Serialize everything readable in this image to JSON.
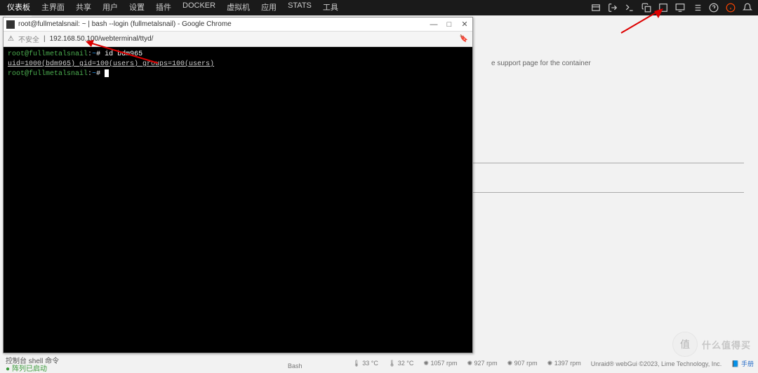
{
  "topbar": {
    "items": [
      "仪表板",
      "主界面",
      "共享",
      "用户",
      "设置",
      "插件",
      "DOCKER",
      "虚拟机",
      "应用",
      "STATS",
      "工具"
    ]
  },
  "chrome": {
    "title": "root@fullmetalsnail: ~ | bash --login (fullmetalsnail) - Google Chrome",
    "insecure": "不安全",
    "url": "192.168.50.100/webterminal/ttyd/",
    "saved_icon_hint": "saved"
  },
  "terminal": {
    "line1_user": "root@fullmetalsnail",
    "line1_sep": ":",
    "line1_path": "~",
    "line1_hash": "# ",
    "line1_cmd": "id bdm965",
    "line2": "uid=1000(bdm965) gid=100(users) groups=100(users)",
    "line3_user": "root@fullmetalsnail",
    "line3_sep": ":",
    "line3_path": "~",
    "line3_hash": "# "
  },
  "bg": {
    "support_text": "e support page for the container"
  },
  "status": {
    "console_label": "控制台 shell 命令",
    "array_started": "阵列已启动",
    "bash_label": "Bash",
    "temp1": "33 °C",
    "temp2": "32 °C",
    "rpm1": "1057 rpm",
    "rpm2": "927 rpm",
    "rpm3": "907 rpm",
    "rpm4": "1397 rpm",
    "copyright": "Unraid® webGui ©2023, Lime Technology, Inc.",
    "manual": "手册"
  },
  "watermark": {
    "circle": "值",
    "text": "什么值得买"
  }
}
